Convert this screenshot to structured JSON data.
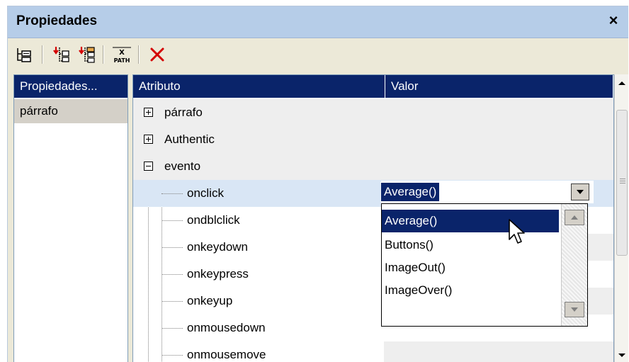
{
  "window": {
    "title": "Propiedades",
    "close_label": "×"
  },
  "toolbar": {
    "buttons": [
      {
        "name": "tree-view-icon"
      },
      {
        "name": "insert-attribute-icon"
      },
      {
        "name": "append-attribute-icon"
      },
      {
        "name": "xpath-icon",
        "text_top": "X",
        "text_bottom": "PATH"
      },
      {
        "name": "delete-icon"
      }
    ]
  },
  "left_panel": {
    "header": "Propiedades...",
    "items": [
      "párrafo"
    ]
  },
  "grid": {
    "columns": [
      "Atributo",
      "Valor"
    ],
    "rows": [
      {
        "label": "párrafo",
        "expander": "plus"
      },
      {
        "label": "Authentic",
        "expander": "plus"
      },
      {
        "label": "evento",
        "expander": "minus"
      },
      {
        "label": "onclick",
        "value": "Average()"
      },
      {
        "label": "ondblclick"
      },
      {
        "label": "onkeydown"
      },
      {
        "label": "onkeypress"
      },
      {
        "label": "onkeyup"
      },
      {
        "label": "onmousedown"
      },
      {
        "label": "onmousemove"
      }
    ]
  },
  "combo": {
    "value": "Average()",
    "options": [
      "Average()",
      "Buttons()",
      "ImageOut()",
      "ImageOver()"
    ],
    "selected_option": "Average()"
  },
  "colors": {
    "header_bg": "#0a246a",
    "titlebar_bg": "#b6cde8",
    "delete_red": "#d40000"
  }
}
